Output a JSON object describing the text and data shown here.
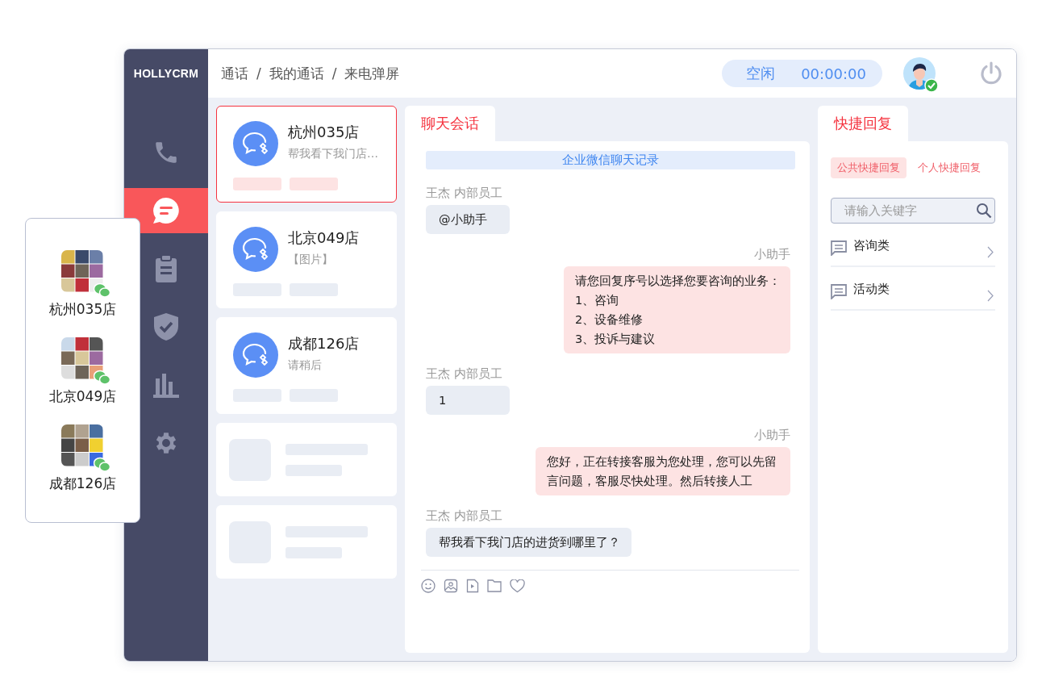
{
  "app": {
    "logo": "HOLLYCRM"
  },
  "nav": [
    {
      "kind": "phone",
      "selected": false
    },
    {
      "kind": "chat",
      "selected": true
    },
    {
      "kind": "clipboard",
      "selected": false
    },
    {
      "kind": "shield",
      "selected": false
    },
    {
      "kind": "chart",
      "selected": false
    },
    {
      "kind": "gear",
      "selected": false
    }
  ],
  "breadcrumb": {
    "items": [
      "通话",
      "我的通话",
      "来电弹屏"
    ],
    "separator": "/"
  },
  "status": {
    "label": "空闲",
    "timer": "00:00:00"
  },
  "user": {
    "online": true
  },
  "contacts": [
    {
      "name": "杭州035店",
      "preview": "帮我看下我门店…",
      "selected": true
    },
    {
      "name": "北京049店",
      "preview": "【图片】",
      "selected": false
    },
    {
      "name": "成都126店",
      "preview": "请稍后",
      "selected": false
    }
  ],
  "loading_cards": [
    {
      "kind": "skeleton"
    },
    {
      "kind": "skeleton"
    }
  ],
  "chat": {
    "tab": {
      "label": "聊天会话",
      "selected": true
    },
    "banner": "企业微信聊天记录",
    "messages": [
      {
        "kind": "incoming",
        "sender": "王杰 内部员工",
        "text": "@小助手"
      },
      {
        "kind": "outgoing",
        "sender": "小助手",
        "text": "请您回复序号以选择您要咨询的业务：\n1、咨询\n2、设备维修\n3、投诉与建议"
      },
      {
        "kind": "incoming",
        "sender": "王杰 内部员工",
        "text": "1"
      },
      {
        "kind": "outgoing",
        "sender": "小助手",
        "text": "您好，正在转接客服为您处理，您可以先留言问题，客服尽快处理。然后转接人工"
      },
      {
        "kind": "incoming",
        "sender": "王杰 内部员工",
        "text": "帮我看下我门店的进货到哪里了？"
      }
    ],
    "tools": [
      {
        "kind": "emoji"
      },
      {
        "kind": "image"
      },
      {
        "kind": "video"
      },
      {
        "kind": "folder"
      },
      {
        "kind": "heart"
      }
    ]
  },
  "quick_reply": {
    "tab": {
      "label": "快捷回复",
      "selected": true
    },
    "filters": [
      {
        "label": "公共快捷回复",
        "selected": true
      },
      {
        "label": "个人快捷回复",
        "selected": false
      }
    ],
    "search": {
      "placeholder": "请输入关键字"
    },
    "categories": [
      "咨询类",
      "活动类"
    ]
  },
  "popup": {
    "groups": [
      {
        "name": "杭州035店"
      },
      {
        "name": "北京049店"
      },
      {
        "name": "成都126店"
      }
    ]
  }
}
